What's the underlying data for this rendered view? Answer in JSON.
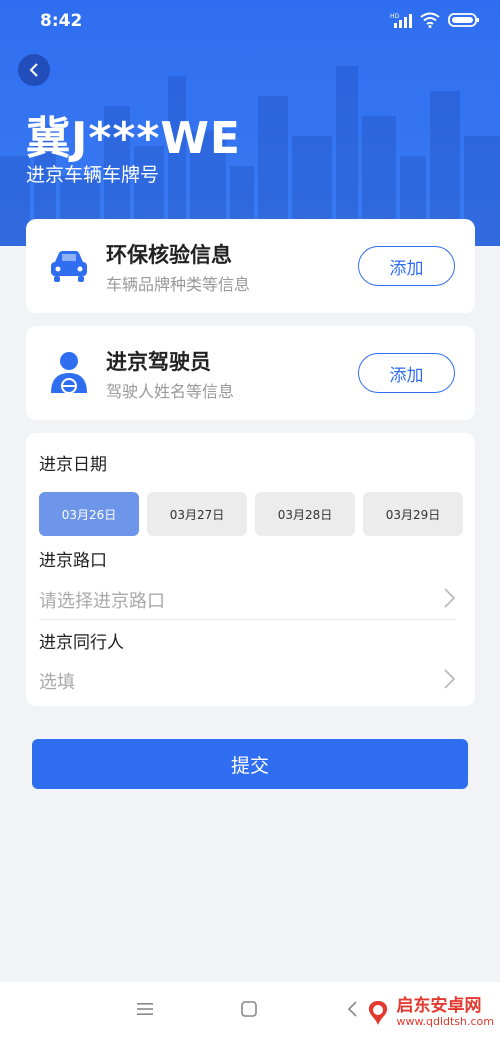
{
  "status_bar": {
    "time": "8:42",
    "network": "HD"
  },
  "header": {
    "plate": "冀J***WE",
    "subtitle": "进京车辆车牌号"
  },
  "cards": [
    {
      "icon": "car-icon",
      "title": "环保核验信息",
      "desc": "车辆品牌种类等信息",
      "button": "添加"
    },
    {
      "icon": "driver-icon",
      "title": "进京驾驶员",
      "desc": "驾驶人姓名等信息",
      "button": "添加"
    }
  ],
  "form": {
    "date_label": "进京日期",
    "dates": [
      "03月26日",
      "03月27日",
      "03月28日",
      "03月29日"
    ],
    "selected_date": "03月26日",
    "entry_label": "进京路口",
    "entry_placeholder": "请选择进京路口",
    "companion_label": "进京同行人",
    "companion_placeholder": "选填"
  },
  "submit_label": "提交",
  "watermark": {
    "title": "启东安卓网",
    "url": "www.qdldtsh.com"
  },
  "colors": {
    "primary": "#2f6ef0",
    "selected_chip": "#6d95ea",
    "background": "#f2f3f7"
  }
}
